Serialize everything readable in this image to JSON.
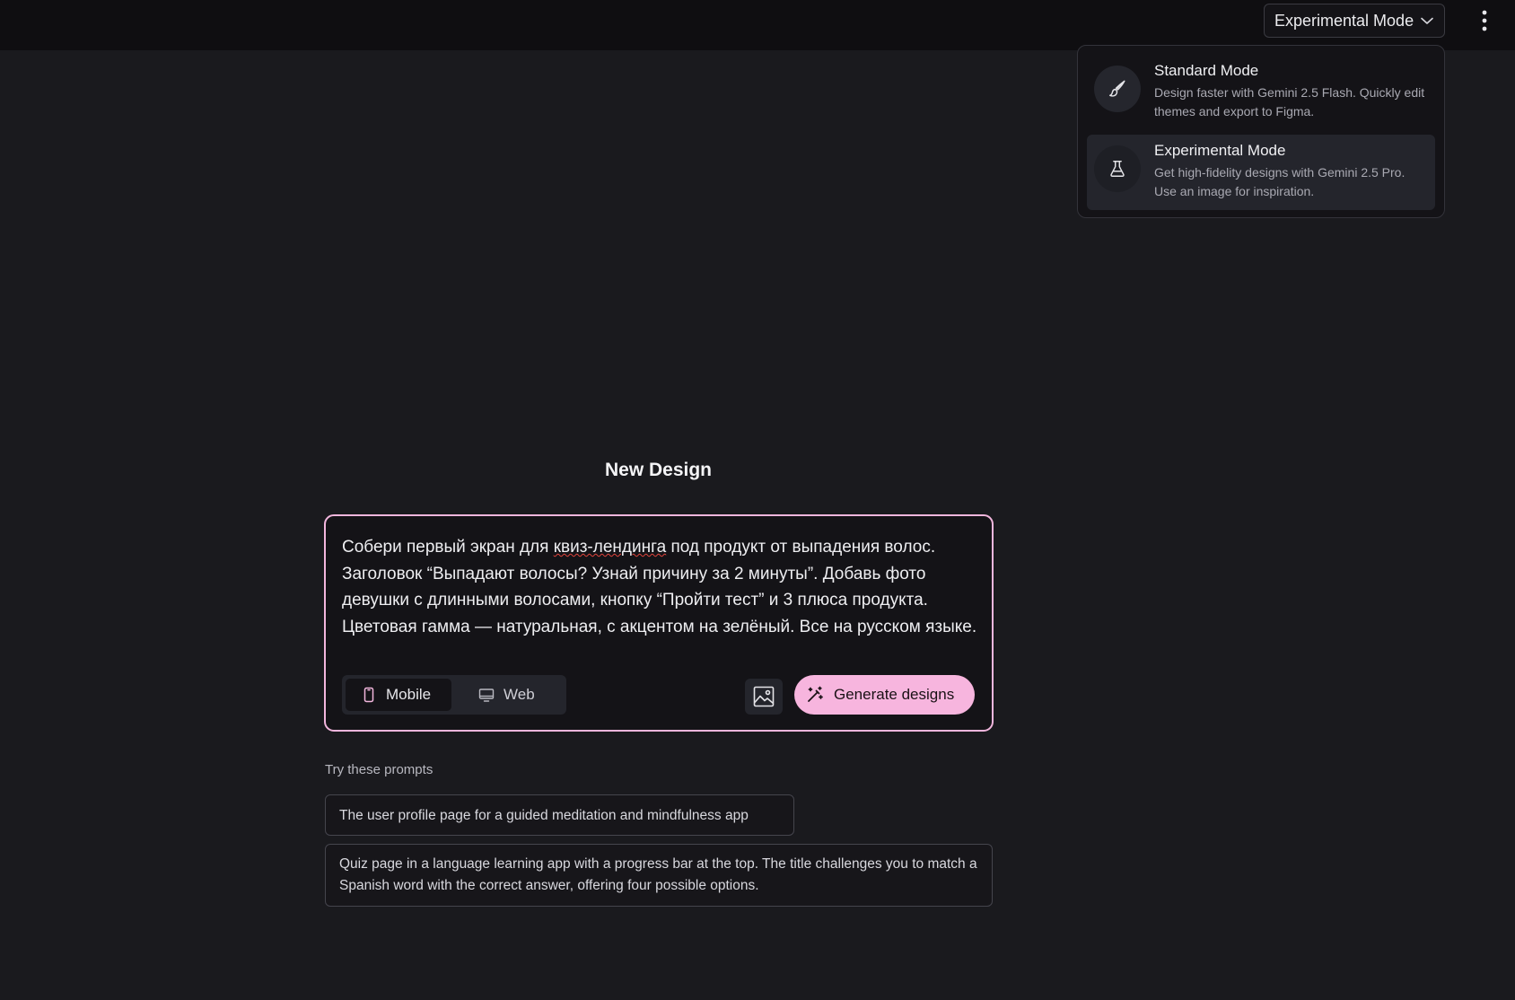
{
  "header": {
    "mode_select_label": "Experimental Mode",
    "icons": {
      "mode_select": "chevron-down-icon",
      "more": "more-vertical-icon"
    }
  },
  "mode_menu": {
    "options": [
      {
        "title": "Standard Mode",
        "description": "Design faster with Gemini 2.5 Flash. Quickly edit themes and export to Figma.",
        "icon": "brush-icon",
        "selected": false
      },
      {
        "title": "Experimental Mode",
        "description": "Get high-fidelity designs with Gemini 2.5 Pro. Use an image for inspiration.",
        "icon": "flask-icon",
        "selected": true
      }
    ]
  },
  "main": {
    "title": "New Design",
    "prompt": {
      "text_before": "Собери первый экран для ",
      "text_misspelled": "квиз-лендинга",
      "text_after": " под продукт от выпадения волос. Заголовок “Выпадают волосы? Узнай причину за 2 минуты”. Добавь фото девушки с длинными волосами, кнопку “Пройти тест” и 3 плюса продукта. Цветовая гамма — натуральная, с акцентом на зелёный. Все на русском языке."
    },
    "device_toggle": {
      "mobile_label": "Mobile",
      "web_label": "Web",
      "selected": "Mobile"
    },
    "generate_label": "Generate designs",
    "colors": {
      "accent": "#f7b5de",
      "prompt_border": "#f2b6dd",
      "background": "#1a1a1e"
    }
  },
  "suggestions": {
    "heading": "Try these prompts",
    "items": [
      "The user profile page for a guided meditation and mindfulness app",
      "Quiz page in a language learning app with a progress bar at the top. The title challenges you to match a Spanish word with the correct answer, offering four possible options."
    ]
  }
}
